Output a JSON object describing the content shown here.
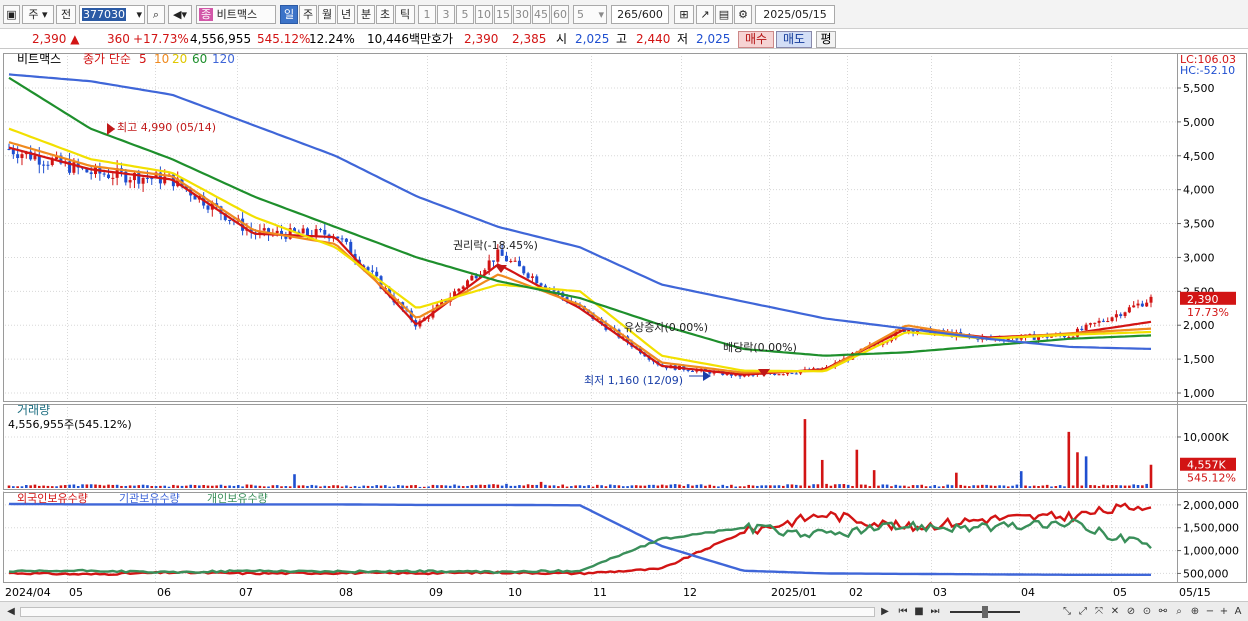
{
  "toolbar": {
    "market": "주",
    "view_all": "전",
    "code": "377030",
    "stock_badge": "종",
    "stock_name": "비트맥스",
    "periods": [
      "일",
      "주",
      "월",
      "년",
      "분",
      "초",
      "틱"
    ],
    "intervals": [
      "1",
      "3",
      "5",
      "10",
      "15",
      "30",
      "45",
      "60"
    ],
    "interval_value": "5",
    "count": "265",
    "count_total": "/600",
    "date": "2025/05/15"
  },
  "quote": {
    "price": "2,390",
    "change": "360",
    "change_pct": "+17.73%",
    "volume": "4,556,955",
    "volume_pct": "545.12%",
    "turnover": "12.24%",
    "amount": "10,446백만",
    "ask_label": "호가",
    "ask": "2,390",
    "bid": "2,385",
    "open_label": "시",
    "open": "2,025",
    "high_label": "고",
    "high": "2,440",
    "low_label": "저",
    "low": "2,025",
    "buy_label": "매수",
    "sell_label": "매도",
    "even_label": "평"
  },
  "price_panel": {
    "name_tag": "비트맥스",
    "indicator": "종가 단순",
    "ma_labels": [
      "5",
      "10",
      "20",
      "60",
      "120"
    ],
    "lc": "LC:106.03",
    "hc": "HC:-52.10",
    "y_ticks": [
      "5,500",
      "5,000",
      "4,500",
      "4,000",
      "3,500",
      "3,000",
      "2,500",
      "2,000",
      "1,500",
      "1,000"
    ],
    "last_price": "2,390",
    "last_pct": "17.73%",
    "high_note": "최고 4,990 (05/14)",
    "low_note": "최저 1,160 (12/09)",
    "event_rights": "권리락(-18.45%)",
    "event_capital": "유상증자(0.00%)",
    "event_dividend": "배당락(0.00%)"
  },
  "volume_panel": {
    "title": "거래량",
    "value": "4,556,955주(545.12%)",
    "y_tick": "10,000K",
    "last": "4,557K",
    "last_pct": "545.12%"
  },
  "holding_panel": {
    "legend": [
      "외국인보유수량",
      "기관보유수량",
      "개인보유수량"
    ],
    "y_ticks": [
      "2,000,000",
      "1,500,000",
      "1,000,000",
      "500,000"
    ]
  },
  "x_axis": [
    "2024/04",
    "05",
    "06",
    "07",
    "08",
    "09",
    "10",
    "11",
    "12",
    "2025/01",
    "02",
    "03",
    "04",
    "05",
    "05/15"
  ],
  "colors": {
    "up": "#d21414",
    "down": "#1f4fd0",
    "ma5": "#d21414",
    "ma10": "#f08a1e",
    "ma20": "#f2e000",
    "ma60": "#1e8f2c",
    "ma120": "#3f66d8",
    "foreign": "#d21414",
    "institution": "#3f66d8",
    "individual": "#3a8f5a"
  },
  "chart_data": [
    {
      "type": "line",
      "title": "비트맥스 일봉",
      "x": [
        "2024/04",
        "05",
        "06",
        "07",
        "08",
        "09",
        "10",
        "11",
        "12",
        "2025/01",
        "02",
        "03",
        "04",
        "05",
        "05/15"
      ],
      "ylim": [
        1000,
        5500
      ],
      "series": [
        {
          "name": "종가",
          "values": [
            4600,
            4250,
            4150,
            3350,
            3350,
            2000,
            3050,
            2250,
            1400,
            1250,
            1350,
            1950,
            1800,
            1850,
            2390
          ]
        },
        {
          "name": "5",
          "values": [
            4620,
            4300,
            4150,
            3350,
            3300,
            2000,
            2900,
            2250,
            1400,
            1270,
            1350,
            1950,
            1820,
            1870,
            2050
          ]
        },
        {
          "name": "10",
          "values": [
            4700,
            4350,
            4200,
            3400,
            3200,
            2100,
            2750,
            2300,
            1450,
            1300,
            1330,
            2000,
            1800,
            1880,
            1950
          ]
        },
        {
          "name": "20",
          "values": [
            4900,
            4450,
            4250,
            3600,
            3150,
            2250,
            2600,
            2500,
            1550,
            1330,
            1320,
            1900,
            1800,
            1860,
            1900
          ]
        },
        {
          "name": "60",
          "values": [
            5650,
            4900,
            4450,
            3900,
            3450,
            3000,
            2650,
            2400,
            2000,
            1650,
            1550,
            1600,
            1700,
            1800,
            1850
          ]
        },
        {
          "name": "120",
          "values": [
            5700,
            5600,
            5400,
            4950,
            4500,
            3900,
            3450,
            3150,
            2600,
            2350,
            2100,
            1950,
            1800,
            1680,
            1650
          ]
        }
      ]
    },
    {
      "type": "bar",
      "title": "거래량",
      "categories": [
        "2024/04",
        "05",
        "06",
        "07",
        "08",
        "09",
        "10",
        "11",
        "12",
        "2025/01",
        "02",
        "03",
        "04",
        "05",
        "05/15"
      ],
      "values": [
        400,
        1200,
        300,
        800,
        300,
        200,
        13500,
        400,
        2500,
        300,
        11000,
        500,
        700,
        500,
        4557
      ],
      "ylabel": "K",
      "ylim": [
        0,
        14500
      ]
    },
    {
      "type": "line",
      "title": "보유수량",
      "x": [
        "2024/04",
        "05",
        "06",
        "07",
        "08",
        "09",
        "10",
        "11",
        "12",
        "2025/01",
        "02",
        "03",
        "04",
        "05",
        "05/15"
      ],
      "ylim": [
        400000,
        2150000
      ],
      "series": [
        {
          "name": "외국인보유수량",
          "values": [
            510000,
            480000,
            520000,
            500000,
            510000,
            505000,
            520000,
            500000,
            600000,
            1400000,
            1800000,
            1500000,
            1700000,
            1750000,
            2020000
          ]
        },
        {
          "name": "기관보유수량",
          "values": [
            2020000,
            2010000,
            2010000,
            2010000,
            2010000,
            2000000,
            2000000,
            1990000,
            1100000,
            560000,
            500000,
            490000,
            480000,
            470000,
            470000
          ]
        },
        {
          "name": "개인보유수량",
          "values": [
            540000,
            560000,
            520000,
            560000,
            540000,
            550000,
            530000,
            560000,
            1250000,
            1500000,
            1350000,
            1550000,
            1500000,
            1600000,
            1100000
          ]
        }
      ]
    }
  ]
}
